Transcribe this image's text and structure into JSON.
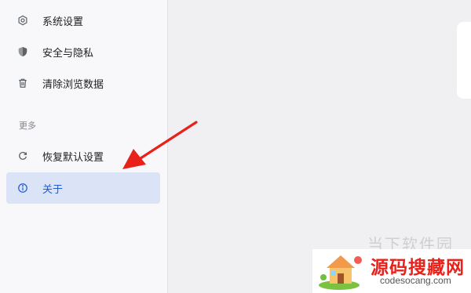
{
  "sidebar": {
    "items": [
      {
        "label": "系统设置",
        "icon": "gear-icon"
      },
      {
        "label": "安全与隐私",
        "icon": "shield-icon"
      },
      {
        "label": "清除浏览数据",
        "icon": "trash-icon"
      }
    ],
    "more_header": "更多",
    "more_items": [
      {
        "label": "恢复默认设置",
        "icon": "restore-icon"
      },
      {
        "label": "关于",
        "icon": "info-icon",
        "selected": true
      }
    ]
  },
  "watermark": {
    "ghost_text": "当下软件园",
    "title": "源码搜藏网",
    "subtitle": "codesocang.com"
  },
  "colors": {
    "accent": "#1f5bd6",
    "selected_background": "#dbe3f7",
    "annotation_arrow": "#e8211b"
  }
}
